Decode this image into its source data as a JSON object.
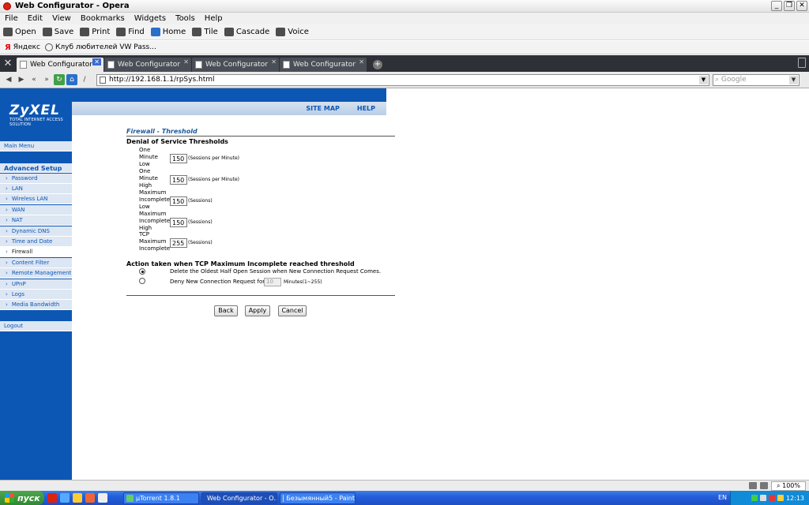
{
  "window": {
    "title": "Web Configurator - Opera"
  },
  "menu": [
    "File",
    "Edit",
    "View",
    "Bookmarks",
    "Widgets",
    "Tools",
    "Help"
  ],
  "toolbar": [
    "Open",
    "Save",
    "Print",
    "Find",
    "Home",
    "Tile",
    "Cascade",
    "Voice"
  ],
  "bookmarks": [
    "Яндекс",
    "Клуб любителей VW Pass..."
  ],
  "tabs": [
    "Web Configurator",
    "Web Configurator",
    "Web Configurator",
    "Web Configurator"
  ],
  "address": {
    "url": "http://192.168.1.1/rpSys.html",
    "search_placeholder": "Google"
  },
  "page": {
    "logo": "ZyXEL",
    "logo_tagline": "TOTAL INTERNET ACCESS SOLUTION",
    "links": [
      "SITE MAP",
      "HELP"
    ],
    "nav": {
      "main_menu": "Main Menu",
      "advanced": "Advanced Setup",
      "items": [
        "Password",
        "LAN",
        "Wireless LAN",
        "WAN",
        "NAT",
        "Dynamic DNS",
        "Time and Date",
        "Firewall",
        "Content Filter",
        "Remote Management",
        "UPnP",
        "Logs",
        "Media Bandwidth Mgnt."
      ],
      "logout": "Logout"
    },
    "title": "Firewall - Threshold",
    "dos_header": "Denial of Service Thresholds",
    "thresholds": [
      {
        "label": "One Minute Low",
        "value": "150",
        "unit": "(Sessions per Minute)"
      },
      {
        "label": "One Minute High",
        "value": "150",
        "unit": "(Sessions per Minute)"
      },
      {
        "label": "Maximum Incomplete Low",
        "value": "150",
        "unit": "(Sessions)"
      },
      {
        "label": "Maximum Incomplete High",
        "value": "150",
        "unit": "(Sessions)"
      },
      {
        "label": "TCP Maximum Incomplete",
        "value": "255",
        "unit": "(Sessions)"
      }
    ],
    "action_header": "Action taken when TCP Maximum Incomplete reached threshold",
    "option1": "Delete the Oldest Half Open Session when New Connection Request Comes.",
    "option2": "Deny New Connection Request for",
    "option2_value": "10",
    "option2_unit": "Minutes(1~255)",
    "buttons": [
      "Back",
      "Apply",
      "Cancel"
    ]
  },
  "status": {
    "zoom": "100%"
  },
  "taskbar": {
    "start": "пуск",
    "tasks": [
      "µTorrent 1.8.1",
      "Web Configurator - O...",
      "Безымянный5 - Paint"
    ],
    "lang": "EN",
    "clock": "12:13"
  }
}
